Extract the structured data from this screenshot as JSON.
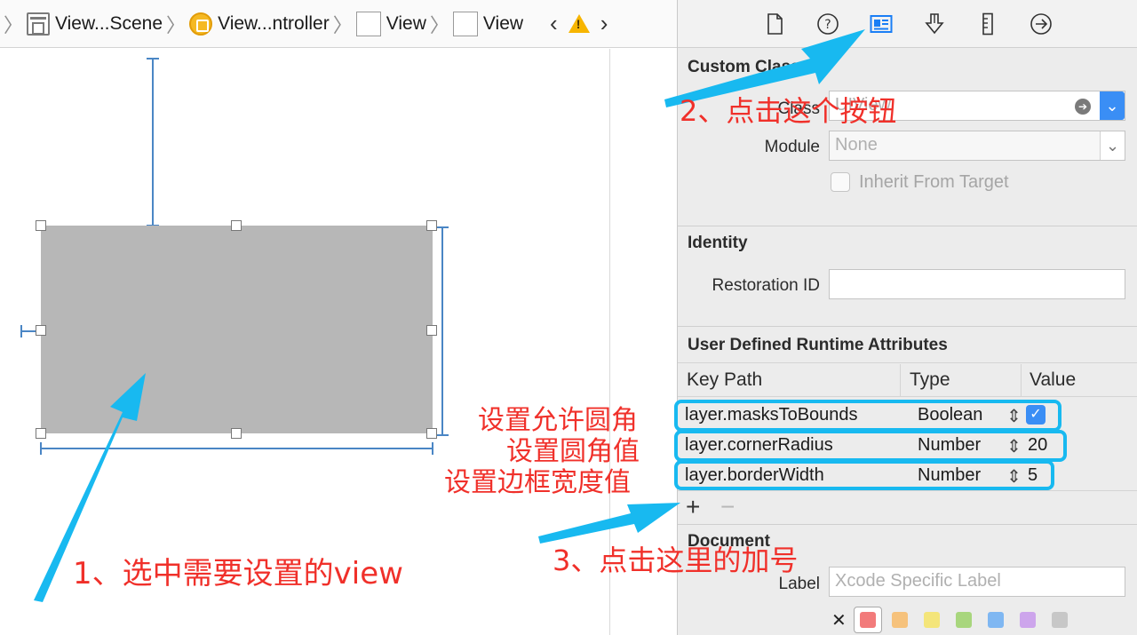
{
  "breadcrumb": {
    "items": [
      {
        "label": "View...Scene",
        "icon": "scene-icon"
      },
      {
        "label": "View...ntroller",
        "icon": "view-controller-icon"
      },
      {
        "label": "View",
        "icon": "view-icon"
      },
      {
        "label": "View",
        "icon": "view-icon"
      }
    ],
    "prev": "‹",
    "next": "›"
  },
  "inspector": {
    "tabs": [
      "file-inspector-icon",
      "quick-help-icon",
      "identity-inspector-icon",
      "attributes-inspector-icon",
      "size-inspector-icon",
      "connections-inspector-icon"
    ],
    "custom_class": {
      "title": "Custom Class",
      "class_label": "Class",
      "class_placeholder": "UIView",
      "module_label": "Module",
      "module_value": "None",
      "inherit_label": "Inherit From Target"
    },
    "identity": {
      "title": "Identity",
      "restoration_label": "Restoration ID",
      "restoration_value": ""
    },
    "runtime_attributes": {
      "title": "User Defined Runtime Attributes",
      "headers": [
        "Key Path",
        "Type",
        "Value"
      ],
      "rows": [
        {
          "key_path": "layer.masksToBounds",
          "type": "Boolean",
          "value": "✓"
        },
        {
          "key_path": "layer.cornerRadius",
          "type": "Number",
          "value": "20"
        },
        {
          "key_path": "layer.borderWidth",
          "type": "Number",
          "value": "5"
        }
      ],
      "add_label": "+",
      "remove_label": "−"
    },
    "document": {
      "title": "Document",
      "label_label": "Label",
      "label_placeholder": "Xcode Specific Label",
      "clear_label": "✕",
      "colors": [
        "#f27b7b",
        "#f6c27c",
        "#f4e57a",
        "#a8d67d",
        "#7fb7f2",
        "#cda5ec",
        "#c7c7c7"
      ]
    }
  },
  "annotations": {
    "step1": "1、选中需要设置的view",
    "step2": "2、点击这个按钮",
    "step3": "3、点击这里的加号",
    "row_notes": [
      "设置允许圆角",
      "设置圆角值",
      "设置边框宽度值"
    ],
    "arrow_color": "#18b9f0",
    "text_color": "#f0302a"
  }
}
